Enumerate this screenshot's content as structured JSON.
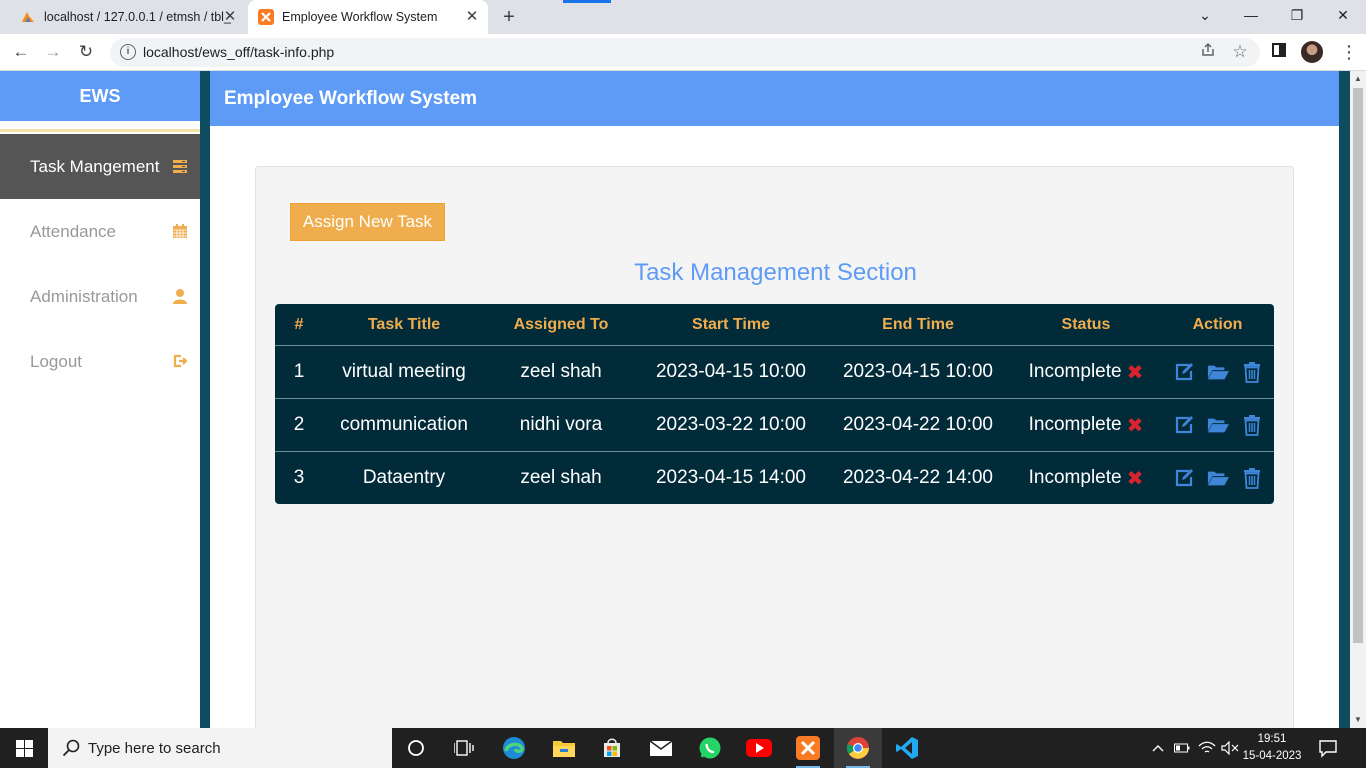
{
  "browser": {
    "tabs": [
      {
        "title": "localhost / 127.0.0.1 / etmsh / tbl_",
        "favicon": "phpmyadmin-icon",
        "active": false
      },
      {
        "title": "Employee Workflow System",
        "favicon": "xampp-icon",
        "active": true
      }
    ],
    "url": "localhost/ews_off/task-info.php"
  },
  "sidebar": {
    "brand": "EWS",
    "items": [
      {
        "label": "Task Mangement",
        "icon": "tasks-icon",
        "active": true
      },
      {
        "label": "Attendance",
        "icon": "calendar-icon",
        "active": false
      },
      {
        "label": "Administration",
        "icon": "user-icon",
        "active": false
      },
      {
        "label": "Logout",
        "icon": "logout-icon",
        "active": false
      }
    ]
  },
  "header": {
    "title": "Employee Workflow System"
  },
  "main": {
    "assign_button": "Assign New Task",
    "section_title": "Task Management Section",
    "table": {
      "columns": [
        "#",
        "Task Title",
        "Assigned To",
        "Start Time",
        "End Time",
        "Status",
        "Action"
      ],
      "rows": [
        {
          "num": "1",
          "title": "virtual meeting",
          "assigned": "zeel shah",
          "start": "2023-04-15 10:00",
          "end": "2023-04-15 10:00",
          "status": "Incomplete"
        },
        {
          "num": "2",
          "title": "communication",
          "assigned": "nidhi vora",
          "start": "2023-03-22 10:00",
          "end": "2023-04-22 10:00",
          "status": "Incomplete"
        },
        {
          "num": "3",
          "title": "Dataentry",
          "assigned": "zeel shah",
          "start": "2023-04-15 14:00",
          "end": "2023-04-22 14:00",
          "status": "Incomplete"
        }
      ]
    }
  },
  "taskbar": {
    "search_placeholder": "Type here to search",
    "time": "19:51",
    "date": "15-04-2023"
  },
  "colors": {
    "accent_blue": "#5e9bf7",
    "table_bg": "#022b3a",
    "header_orange": "#f0ad4e",
    "status_red": "#d9232e",
    "action_blue": "#3f86d9"
  }
}
